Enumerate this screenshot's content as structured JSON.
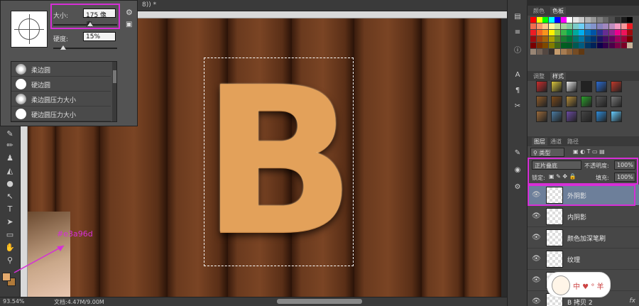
{
  "document": {
    "tab_title": "8)) *",
    "zoom": "93.54%",
    "doc_info": "文档:4.47M/9.00M"
  },
  "brush_picker": {
    "size_label": "大小:",
    "size_value": "175 像素",
    "size_fraction": 0.58,
    "hardness_label": "硬度:",
    "hardness_value": "15%",
    "hardness_fraction": 0.15,
    "presets": [
      {
        "name": "柔边圆",
        "soft": true
      },
      {
        "name": "硬边圆",
        "soft": false
      },
      {
        "name": "柔边圆压力大小",
        "soft": true
      },
      {
        "name": "硬边圆压力大小",
        "soft": false
      }
    ]
  },
  "canvas": {
    "letter": "B"
  },
  "annotation": {
    "color_note": "#e3a96d",
    "accent": "#d62fd6"
  },
  "swatches_panel": {
    "tabs": [
      "颜色",
      "色板"
    ],
    "active_tab": "色板",
    "colors": [
      "#ff0000",
      "#ffff00",
      "#00ff00",
      "#00ffff",
      "#0000ff",
      "#ff00ff",
      "#ffffff",
      "#e6e6e6",
      "#cccccc",
      "#b3b3b3",
      "#999999",
      "#808080",
      "#666666",
      "#4d4d4d",
      "#333333",
      "#1a1a1a",
      "#000000",
      "#f26c4f",
      "#f7976a",
      "#fdc68a",
      "#fff799",
      "#c4df9b",
      "#a3d39c",
      "#82ca9d",
      "#7accc8",
      "#6dcff6",
      "#7da7d9",
      "#8393ca",
      "#8781bd",
      "#a187be",
      "#bc8dbf",
      "#f49ac2",
      "#f6989d",
      "#ed1c24",
      "#ed1c24",
      "#f26522",
      "#f7941d",
      "#fff200",
      "#8dc73f",
      "#39b54a",
      "#00a651",
      "#00a99d",
      "#00aeef",
      "#0072bc",
      "#0054a6",
      "#2e3192",
      "#662d91",
      "#92278f",
      "#ec008c",
      "#ed145b",
      "#9e0b0f",
      "#9e0b0f",
      "#a0410d",
      "#a36209",
      "#aba000",
      "#598527",
      "#1a7b30",
      "#007236",
      "#00746b",
      "#0076a3",
      "#004b80",
      "#003471",
      "#1b1464",
      "#440e62",
      "#630460",
      "#9e005d",
      "#9e0039",
      "#790000",
      "#790000",
      "#7b2e00",
      "#7d4900",
      "#827b00",
      "#406618",
      "#005e20",
      "#005826",
      "#005952",
      "#005b7f",
      "#003663",
      "#002157",
      "#0d004c",
      "#32004b",
      "#4b0049",
      "#7b0046",
      "#7a0026",
      "#c7b299",
      "#998675",
      "#736357",
      "#534741",
      "#37302d",
      "#c69c6d",
      "#a67c52",
      "#8c6239",
      "#754c24",
      "#603913"
    ]
  },
  "styles_panel": {
    "tabs": [
      "调整",
      "样式"
    ],
    "active_tab": "样式",
    "styles": [
      "#c92c2c",
      "#d8c43c",
      "#e8e8e8",
      "#222222",
      "#2b6bd1",
      "#c0392b",
      "#8a5a2b",
      "#7a4a1b",
      "#b08a3a",
      "#2ca02c",
      "#555555",
      "#777777",
      "#9a6a3a",
      "#4a7aa0",
      "#6a4aa0",
      "#444444",
      "#2e8bd8",
      "#66ccff"
    ]
  },
  "layers_panel": {
    "tabs": [
      "图层",
      "通道",
      "路径"
    ],
    "active_tab": "图层",
    "kind_label": "类型",
    "blend_mode": "正片叠底",
    "opacity_label": "不透明度:",
    "opacity_value": "100%",
    "lock_label": "锁定:",
    "fill_label": "填充:",
    "fill_value": "100%",
    "layers": [
      {
        "name": "外阴影",
        "active": true,
        "fx": ""
      },
      {
        "name": "内阴影",
        "active": false,
        "fx": ""
      },
      {
        "name": "颜色加深笔刷",
        "active": false,
        "fx": ""
      },
      {
        "name": "纹理",
        "active": false,
        "fx": ""
      },
      {
        "name": "行色",
        "active": false,
        "fx": ""
      },
      {
        "name": "B 拷贝 2",
        "active": false,
        "fx": "fx"
      }
    ]
  },
  "sticker": {
    "text": "中 ♥ ° 羊"
  }
}
